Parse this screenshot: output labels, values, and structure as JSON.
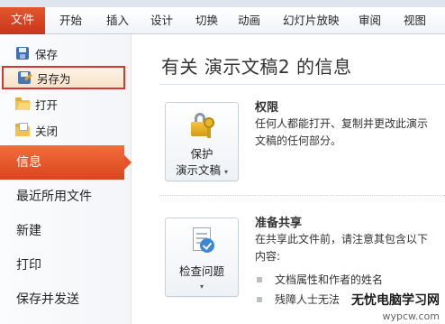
{
  "ribbon": {
    "tabs": [
      {
        "label": "文件",
        "active": true
      },
      {
        "label": "开始"
      },
      {
        "label": "插入"
      },
      {
        "label": "设计"
      },
      {
        "label": "切换"
      },
      {
        "label": "动画"
      },
      {
        "label": "幻灯片放映"
      },
      {
        "label": "审阅"
      },
      {
        "label": "视图"
      }
    ]
  },
  "nav": {
    "commands": [
      {
        "label": "保存",
        "icon": "save-icon"
      },
      {
        "label": "另存为",
        "icon": "save-as-icon",
        "highlighted": true
      },
      {
        "label": "打开",
        "icon": "open-folder-icon"
      },
      {
        "label": "关闭",
        "icon": "close-file-icon"
      }
    ],
    "tabs": [
      {
        "label": "信息",
        "active": true
      },
      {
        "label": "最近所用文件"
      },
      {
        "label": "新建"
      },
      {
        "label": "打印"
      },
      {
        "label": "保存并发送"
      }
    ]
  },
  "info": {
    "title": "有关 演示文稿2 的信息",
    "permissions": {
      "button_line1": "保护",
      "button_line2": "演示文稿",
      "button_arrow": "▾",
      "heading": "权限",
      "description": "任何人都能打开、复制并更改此演示文稿的任何部分。"
    },
    "prepare": {
      "button_label": "检查问题",
      "button_arrow": "▾",
      "heading": "准备共享",
      "description": "在共享此文件前，请注意其包含以下内容:",
      "bullets": [
        "文档属性和作者的姓名",
        "残障人士无法"
      ]
    }
  },
  "watermark": {
    "line1": "无忧电脑学习网",
    "line2": "wypcw.com"
  },
  "colors": {
    "file_tab": "#d4421f",
    "active_nav": "#e4562a",
    "highlight_border": "#d03a31"
  }
}
